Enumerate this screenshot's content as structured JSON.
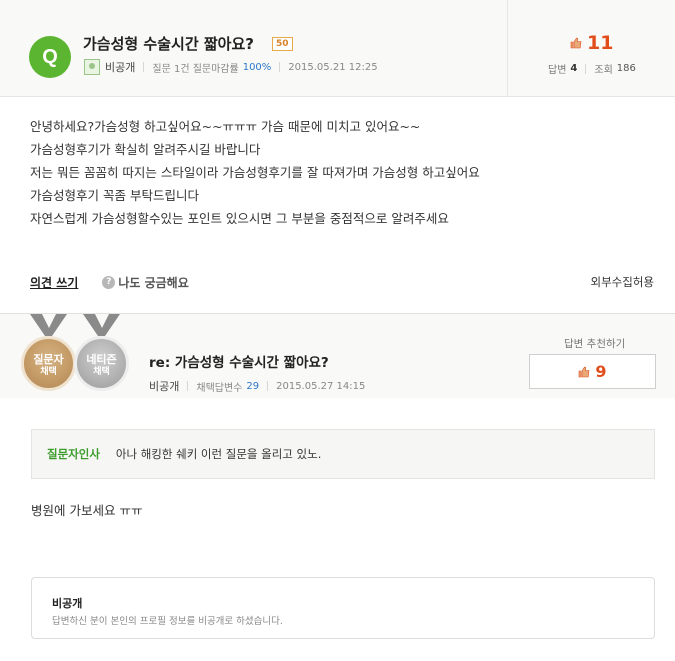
{
  "question": {
    "badge": "Q",
    "title": "가슴성형 수술시간 짧아요?",
    "points": "50",
    "author": "비공개",
    "question_stats": "질문 1건 질문마감률",
    "close_rate": "100%",
    "date": "2015.05.21 12:25",
    "likes": "11",
    "answers_label": "답변",
    "answers_count": "4",
    "views_label": "조회",
    "views_count": "186",
    "body_lines": [
      "안녕하세요?가슴성형 하고싶어요~~ㅠㅠㅠ 가슴 때문에 미치고 있어요~~",
      "가슴성형후기가 확실히 알려주시길 바랍니다",
      "저는 뭐든 꼼꼼히 따지는 스타일이라 가슴성형후기를 잘 따져가며 가슴성형 하고싶어요",
      "가슴성형후기 꼭좀 부탁드립니다",
      "자연스럽게 가슴성형할수있는 포인트 있으시면 그 부분을 중점적으로 알려주세요"
    ],
    "opinion_link": "의견 쓰기",
    "curious_icon": "?",
    "curious_label": "나도 궁금해요",
    "external_label": "외부수집허용"
  },
  "answer": {
    "medal_asker_line1": "질문자",
    "medal_asker_line2": "채택",
    "medal_netizen_line1": "네티즌",
    "medal_netizen_line2": "채택",
    "title": "re: 가슴성형 수술시간 짧아요?",
    "author": "비공개",
    "adopted_label": "채택답변수",
    "adopted_count": "29",
    "date": "2015.05.27 14:15",
    "recommend_label": "답변 추천하기",
    "recommend_count": "9",
    "greeting_label": "질문자인사",
    "greeting_text": "아나 해킹한 쉐키 이런 질문을 올리고 있노.",
    "body": "병원에 가보세요 ㅠㅠ",
    "private_title": "비공개",
    "private_desc": "답변하신 분이 본인의 프로필 정보를 비공개로 하셨습니다."
  },
  "colors": {
    "badge_green": "#5cb531",
    "like_orange": "#e04e1c",
    "greeting_green": "#3c9d2c",
    "link_blue": "#2d78c8"
  },
  "icons": {
    "thumb": "thumbs-up-icon",
    "curious": "question-circle-icon",
    "profile": "profile-placeholder-icon"
  }
}
